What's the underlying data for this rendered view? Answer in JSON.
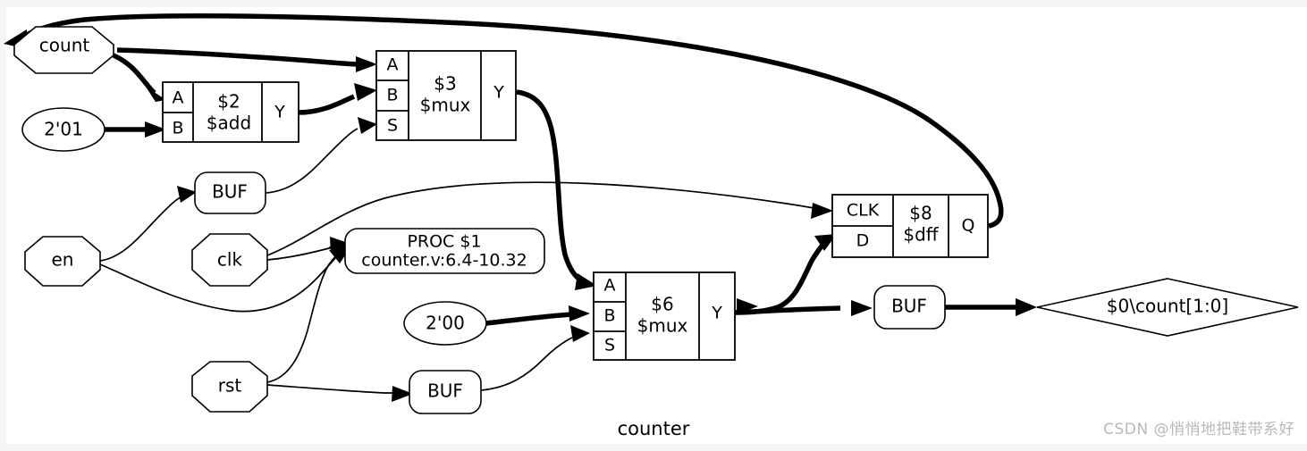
{
  "diagram": {
    "title": "counter",
    "watermark": "CSDN @悄悄地把鞋带系好",
    "io_nodes": [
      {
        "id": "count",
        "label": "count",
        "shape": "octagon"
      },
      {
        "id": "en",
        "label": "en",
        "shape": "octagon"
      },
      {
        "id": "clk",
        "label": "clk",
        "shape": "octagon"
      },
      {
        "id": "rst",
        "label": "rst",
        "shape": "octagon"
      }
    ],
    "const_nodes": [
      {
        "id": "c201",
        "label": "2'01",
        "shape": "ellipse"
      },
      {
        "id": "c200",
        "label": "2'00",
        "shape": "ellipse"
      }
    ],
    "buf_nodes": [
      {
        "id": "buf_en",
        "label": "BUF"
      },
      {
        "id": "buf_rst",
        "label": "BUF"
      },
      {
        "id": "buf_out",
        "label": "BUF"
      }
    ],
    "proc_node": {
      "id": "proc1",
      "line1": "PROC $1",
      "line2": "counter.v:6.4-10.32"
    },
    "output_node": {
      "id": "out_count",
      "label": "$0\\count[1:0]",
      "shape": "diamond"
    },
    "cells": [
      {
        "id": "add2",
        "name": "$2",
        "type": "$add",
        "inputs": [
          "A",
          "B"
        ],
        "outputs": [
          "Y"
        ]
      },
      {
        "id": "mux3",
        "name": "$3",
        "type": "$mux",
        "inputs": [
          "A",
          "B",
          "S"
        ],
        "outputs": [
          "Y"
        ]
      },
      {
        "id": "mux6",
        "name": "$6",
        "type": "$mux",
        "inputs": [
          "A",
          "B",
          "S"
        ],
        "outputs": [
          "Y"
        ]
      },
      {
        "id": "dff8",
        "name": "$8",
        "type": "$dff",
        "inputs": [
          "CLK",
          "D"
        ],
        "outputs": [
          "Q"
        ]
      }
    ],
    "colors": {
      "background": "#ffffff",
      "stroke": "#000000",
      "frame": "#f5f5f5",
      "watermark": "#b9b9b9"
    }
  }
}
